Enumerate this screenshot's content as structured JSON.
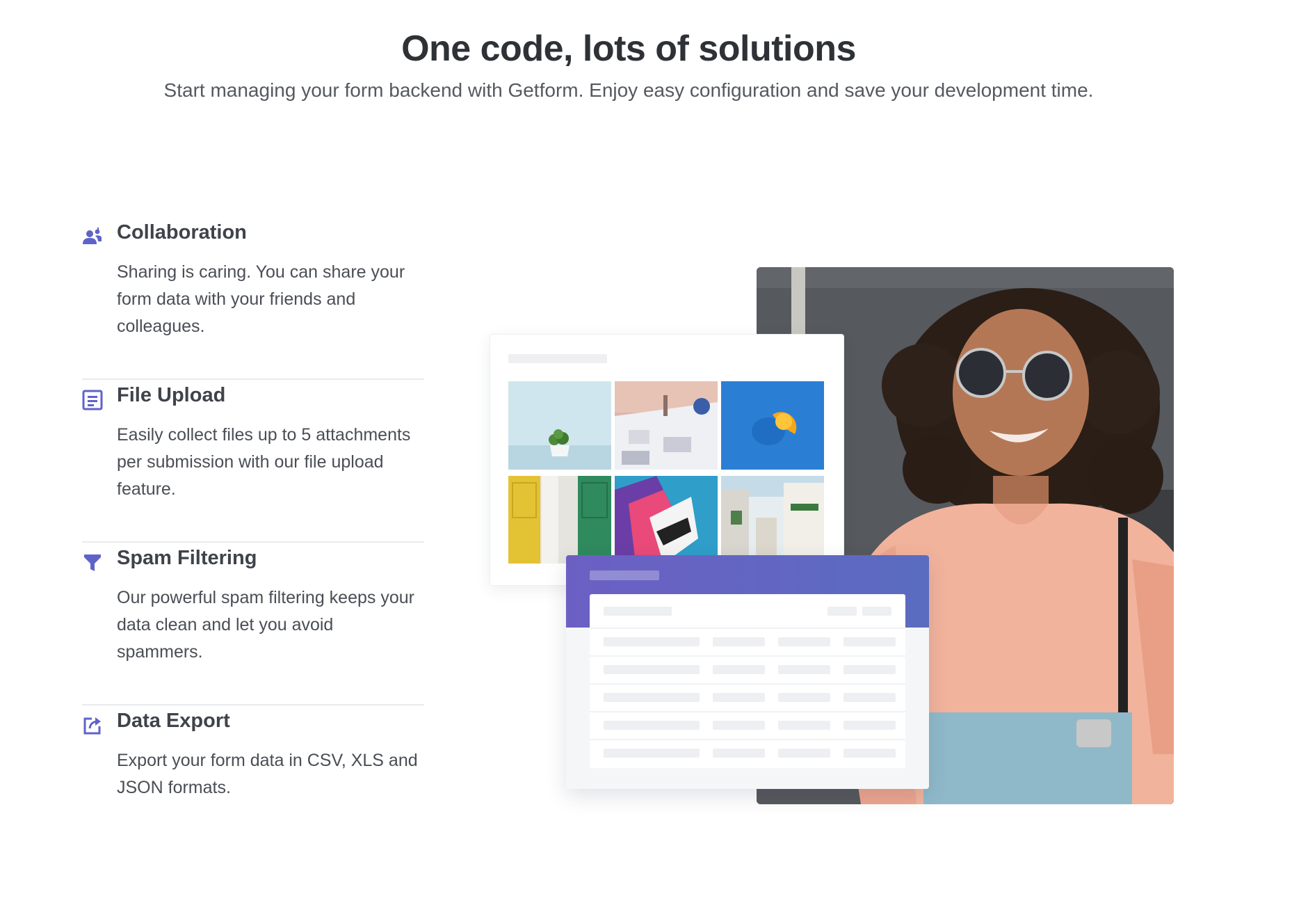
{
  "section": {
    "title": "One code, lots of solutions",
    "subtitle": "Start managing your form backend with Getform. Enjoy easy configuration and save your development time."
  },
  "features": [
    {
      "icon": "users-icon",
      "title": "Collaboration",
      "description": "Sharing is caring. You can share your form data with your friends and colleagues."
    },
    {
      "icon": "file-upload-icon",
      "title": "File Upload",
      "description": "Easily collect files up to 5 attachments per submission with our file upload feature."
    },
    {
      "icon": "filter-icon",
      "title": "Spam Filtering",
      "description": "Our powerful spam filtering keeps your data clean and let you avoid spammers."
    },
    {
      "icon": "export-icon",
      "title": "Data Export",
      "description": "Export your form data in CSV, XLS and JSON formats."
    }
  ],
  "colors": {
    "accent": "#5f63c8",
    "heading": "#2e3136",
    "body_text": "#4a4e55",
    "divider": "#e9eaee",
    "band_start": "#6c5fc4",
    "band_end": "#5a6cc0"
  },
  "illustration": {
    "gallery_thumbnails": [
      "plant-photo",
      "santorini-photo",
      "orange-photo",
      "doors-photo",
      "building-photo",
      "street-photo"
    ],
    "photo": "woman-with-sunglasses-photo"
  }
}
